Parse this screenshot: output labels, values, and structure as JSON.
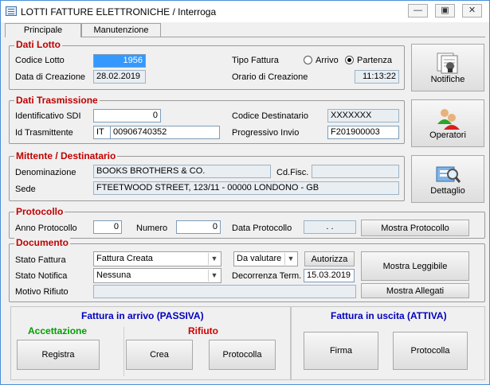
{
  "window": {
    "title": "LOTTI FATTURE ELETTRONICHE / Interroga"
  },
  "tabs": [
    {
      "label": "Principale",
      "active": true
    },
    {
      "label": "Manutenzione",
      "active": false
    }
  ],
  "dati_lotto": {
    "title": "Dati Lotto",
    "codice_lotto_label": "Codice Lotto",
    "codice_lotto_value": "1956",
    "data_creazione_label": "Data di Creazione",
    "data_creazione_value": "28.02.2019",
    "tipo_fattura_label": "Tipo Fattura",
    "tipo_options": [
      {
        "label": "Arrivo",
        "selected": false
      },
      {
        "label": "Partenza",
        "selected": true
      }
    ],
    "orario_label": "Orario di Creazione",
    "orario_value": "11:13:22"
  },
  "dati_trasmissione": {
    "title": "Dati Trasmissione",
    "id_sdi_label": "Identificativo SDI",
    "id_sdi_value": "0",
    "id_trasmittente_label": "Id Trasmittente",
    "id_trasmittente_country": "IT",
    "id_trasmittente_code": "00906740352",
    "codice_dest_label": "Codice Destinatario",
    "codice_dest_value": "XXXXXXX",
    "progressivo_label": "Progressivo Invio",
    "progressivo_value": "F201900003"
  },
  "mittente": {
    "title": "Mittente / Destinatario",
    "denominazione_label": "Denominazione",
    "denominazione_value": "BOOKS BROTHERS & CO.",
    "cdfisc_label": "Cd.Fisc.",
    "cdfisc_value": "",
    "sede_label": "Sede",
    "sede_value": "FTEETWOOD STREET, 123/11 - 00000 LONDONO - GB"
  },
  "protocollo": {
    "title": "Protocollo",
    "anno_label": "Anno Protocollo",
    "anno_value": "0",
    "numero_label": "Numero",
    "numero_value": "0",
    "data_label": "Data Protocollo",
    "data_value": ". .",
    "mostra_button": "Mostra Protocollo"
  },
  "documento": {
    "title": "Documento",
    "stato_fattura_label": "Stato Fattura",
    "stato_fattura_value": "Fattura Creata",
    "valutare_value": "Da valutare",
    "autorizza_button": "Autorizza",
    "stato_notifica_label": "Stato Notifica",
    "stato_notifica_value": "Nessuna",
    "decorrenza_label": "Decorrenza Term.",
    "decorrenza_value": "15.03.2019",
    "motivo_label": "Motivo Rifiuto",
    "motivo_value": "",
    "mostra_leggibile_button": "Mostra Leggibile",
    "mostra_allegati_button": "Mostra Allegati"
  },
  "side_buttons": {
    "notifiche": "Notifiche",
    "operatori": "Operatori",
    "dettaglio": "Dettaglio"
  },
  "passiva": {
    "title": "Fattura in arrivo (PASSIVA)",
    "accettazione_label": "Accettazione",
    "rifiuto_label": "Rifiuto",
    "registra_button": "Registra",
    "crea_button": "Crea",
    "protocolla_button": "Protocolla"
  },
  "attiva": {
    "title": "Fattura in uscita (ATTIVA)",
    "firma_button": "Firma",
    "protocolla_button": "Protocolla"
  },
  "colors": {
    "section_title": "#c00000",
    "passiva_title": "#0000c0",
    "accettazione": "#00a000",
    "rifiuto": "#d00000",
    "selection": "#3399ff"
  },
  "icons": [
    "app-icon",
    "minimize-icon",
    "maximize-icon",
    "close-icon",
    "notifiche-icon",
    "operatori-icon",
    "dettaglio-icon"
  ]
}
